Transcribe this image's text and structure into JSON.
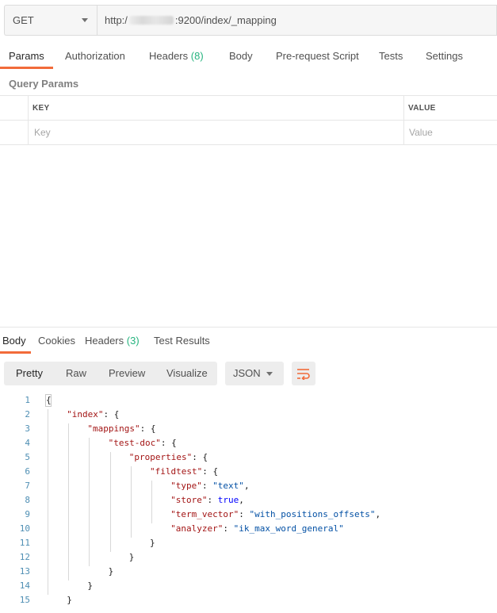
{
  "request": {
    "method": "GET",
    "url_prefix": "http:/ ",
    "url_suffix": ":9200/index/_mapping"
  },
  "request_tabs": [
    {
      "label": "Params",
      "badge": ""
    },
    {
      "label": "Authorization",
      "badge": ""
    },
    {
      "label": "Headers",
      "badge": "(8)"
    },
    {
      "label": "Body",
      "badge": ""
    },
    {
      "label": "Pre-request Script",
      "badge": ""
    },
    {
      "label": "Tests",
      "badge": ""
    },
    {
      "label": "Settings",
      "badge": ""
    }
  ],
  "query_params": {
    "title": "Query Params",
    "header_key": "KEY",
    "header_value": "VALUE",
    "placeholder_key": "Key",
    "placeholder_value": "Value"
  },
  "response_tabs": [
    {
      "label": "Body",
      "badge": ""
    },
    {
      "label": "Cookies",
      "badge": ""
    },
    {
      "label": "Headers",
      "badge": "(3)"
    },
    {
      "label": "Test Results",
      "badge": ""
    }
  ],
  "view_modes": [
    "Pretty",
    "Raw",
    "Preview",
    "Visualize"
  ],
  "format": "JSON",
  "icons": {
    "wrap": "wrap-lines-icon",
    "method_dropdown": "chevron-down-icon",
    "format_dropdown": "chevron-down-icon"
  },
  "colors": {
    "accent": "#f26b3a",
    "badge": "#26b47f",
    "json_key": "#a31515",
    "json_string": "#0451a5",
    "json_bool": "#0000ff",
    "line_number": "#4f8fb4"
  },
  "code_lines": [
    {
      "num": "1",
      "key": "",
      "sep": "",
      "val": "",
      "vtype": "",
      "tail": "{"
    },
    {
      "num": "2",
      "key": "\"index\"",
      "sep": ": ",
      "val": "",
      "vtype": "",
      "tail": "{"
    },
    {
      "num": "3",
      "key": "\"mappings\"",
      "sep": ": ",
      "val": "",
      "vtype": "",
      "tail": "{"
    },
    {
      "num": "4",
      "key": "\"test-doc\"",
      "sep": ": ",
      "val": "",
      "vtype": "",
      "tail": "{"
    },
    {
      "num": "5",
      "key": "\"properties\"",
      "sep": ": ",
      "val": "",
      "vtype": "",
      "tail": "{"
    },
    {
      "num": "6",
      "key": "\"fildtest\"",
      "sep": ": ",
      "val": "",
      "vtype": "",
      "tail": "{"
    },
    {
      "num": "7",
      "key": "\"type\"",
      "sep": ": ",
      "val": "\"text\"",
      "vtype": "s",
      "tail": ","
    },
    {
      "num": "8",
      "key": "\"store\"",
      "sep": ": ",
      "val": "true",
      "vtype": "b",
      "tail": ","
    },
    {
      "num": "9",
      "key": "\"term_vector\"",
      "sep": ": ",
      "val": "\"with_positions_offsets\"",
      "vtype": "s",
      "tail": ","
    },
    {
      "num": "10",
      "key": "\"analyzer\"",
      "sep": ": ",
      "val": "\"ik_max_word_general\"",
      "vtype": "s",
      "tail": ""
    },
    {
      "num": "11",
      "key": "",
      "sep": "",
      "val": "",
      "vtype": "",
      "tail": "}"
    },
    {
      "num": "12",
      "key": "",
      "sep": "",
      "val": "",
      "vtype": "",
      "tail": "}"
    },
    {
      "num": "13",
      "key": "",
      "sep": "",
      "val": "",
      "vtype": "",
      "tail": "}"
    },
    {
      "num": "14",
      "key": "",
      "sep": "",
      "val": "",
      "vtype": "",
      "tail": "}"
    },
    {
      "num": "15",
      "key": "",
      "sep": "",
      "val": "",
      "vtype": "",
      "tail": "}"
    }
  ]
}
